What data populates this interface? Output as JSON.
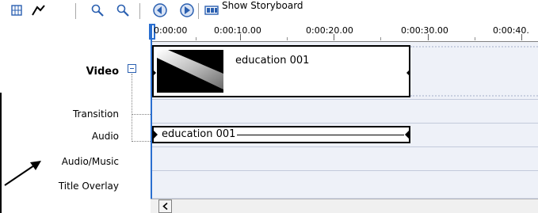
{
  "toolbar": {
    "show_storyboard_label": "Show Storyboard"
  },
  "ruler": {
    "ticks": [
      "0:00:00",
      "0:00:10.00",
      "0:00:20.00",
      "0:00:30.00",
      "0:00:40."
    ]
  },
  "tracks": {
    "video_label": "Video",
    "transition_label": "Transition",
    "audio_label": "Audio",
    "audiomusic_label": "Audio/Music",
    "title_overlay_label": "Title Overlay"
  },
  "clips": {
    "video_clip_title": "education 001",
    "audio_clip_title": "education 001"
  },
  "colors": {
    "accent_blue": "#2a6fd0",
    "track_bg": "#eef1f8"
  }
}
